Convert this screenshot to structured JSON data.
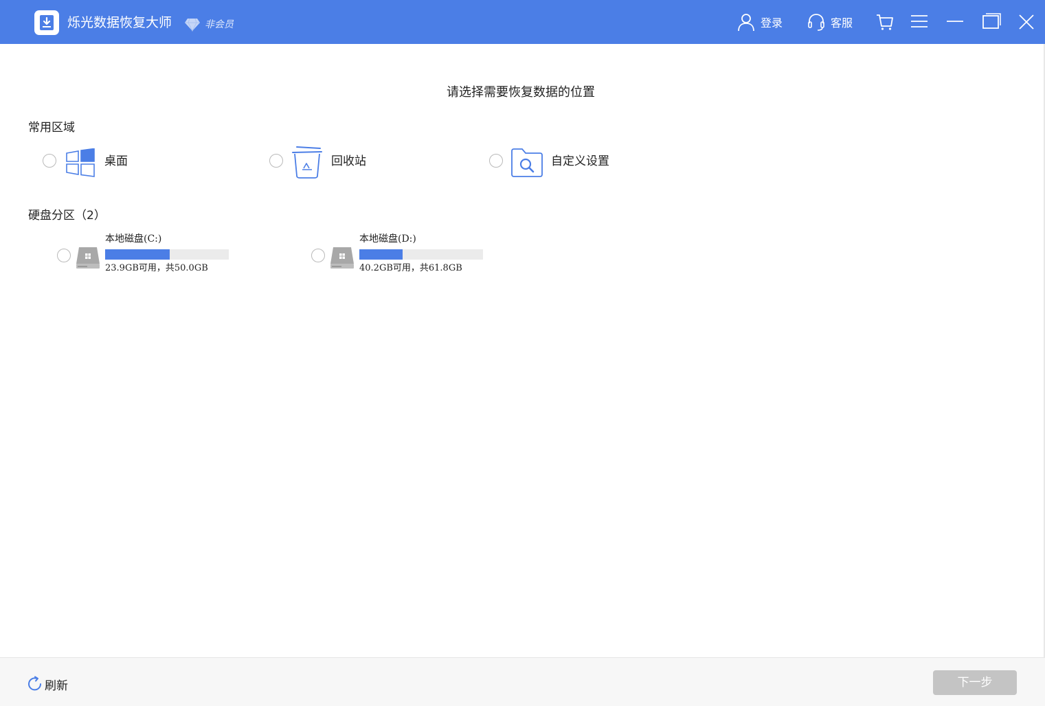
{
  "titlebar": {
    "app_name": "烁光数据恢复大师",
    "membership": "非会员",
    "login_label": "登录",
    "service_label": "客服"
  },
  "main": {
    "title": "请选择需要恢复数据的位置",
    "common_section": "常用区域",
    "locations": [
      {
        "label": "桌面",
        "icon": "windows-icon"
      },
      {
        "label": "回收站",
        "icon": "recycle-bin-icon"
      },
      {
        "label": "自定义设置",
        "icon": "folder-search-icon"
      }
    ],
    "disk_section": "硬盘分区（2）",
    "disks": [
      {
        "name": "本地磁盘(C:)",
        "info": "23.9GB可用，共50.0GB",
        "used_fraction": 0.522
      },
      {
        "name": "本地磁盘(D:)",
        "info": "40.2GB可用，共61.8GB",
        "used_fraction": 0.35
      }
    ]
  },
  "footer": {
    "refresh_label": "刷新",
    "next_label": "下一步"
  },
  "colors": {
    "accent": "#4b7ee6",
    "disabled_button": "#c4c4c4"
  }
}
